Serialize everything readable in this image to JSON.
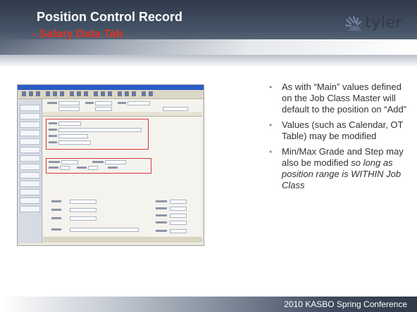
{
  "header": {
    "title": "Position Control Record",
    "subtitle": "- Salary Data Tab"
  },
  "logo": {
    "text": "tyler",
    "icon": "tyler-logo-icon"
  },
  "bullets": [
    {
      "text": "As with “Main” values defined on the Job Class Master will default to the position on “Add”"
    },
    {
      "text": "Values (such as Calendar, OT Table) may be modified"
    },
    {
      "text_plain": "Min/Max Grade and Step may also be modified ",
      "text_italic": "so long as position range is WITHIN Job Class"
    }
  ],
  "footer": {
    "text": "2010 KASBO Spring Conference"
  },
  "colors": {
    "title": "#ffffff",
    "subtitle": "#e0301e",
    "bullet_marker": "#7f8fa8",
    "highlight_box": "#d63a3a"
  }
}
